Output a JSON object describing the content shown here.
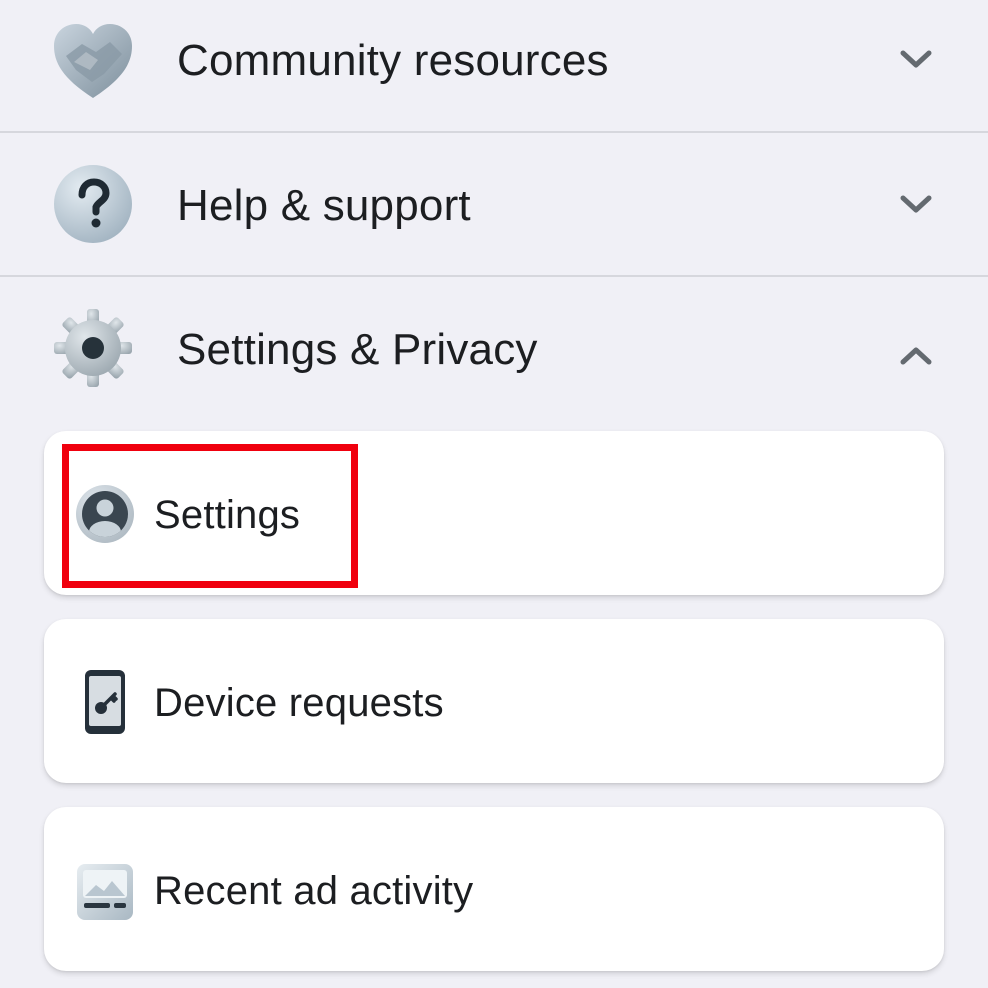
{
  "menu": {
    "sections": [
      {
        "label": "Community resources",
        "icon": "handshake-heart-icon",
        "state": "collapsed"
      },
      {
        "label": "Help & support",
        "icon": "question-mark-icon",
        "state": "collapsed"
      },
      {
        "label": "Settings & Privacy",
        "icon": "gear-icon",
        "state": "expanded"
      }
    ],
    "settings_privacy_items": [
      {
        "label": "Settings",
        "icon": "user-avatar-icon"
      },
      {
        "label": "Device requests",
        "icon": "phone-key-icon"
      },
      {
        "label": "Recent ad activity",
        "icon": "ad-image-icon"
      }
    ]
  },
  "highlight": {
    "color": "#f0000e"
  }
}
